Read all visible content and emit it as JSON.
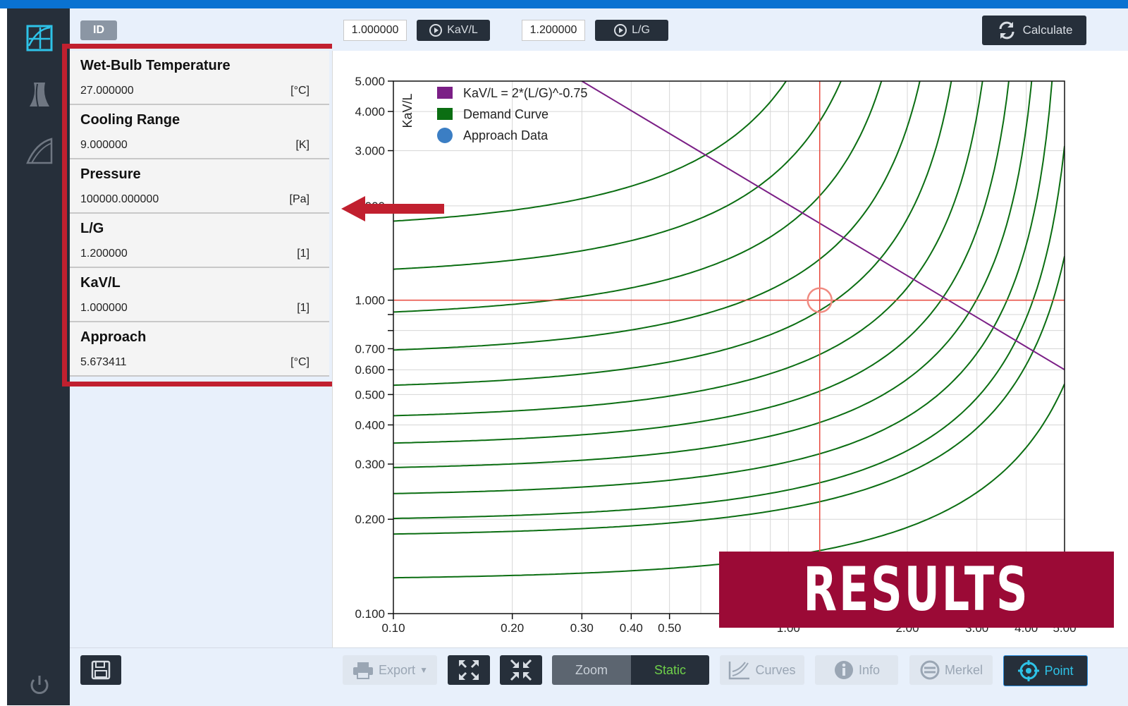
{
  "sidebar": {
    "icons": [
      "chart-icon",
      "tower-icon",
      "curve-icon",
      "power-icon"
    ]
  },
  "left_panel": {
    "id_label": "ID",
    "properties": [
      {
        "name": "Wet-Bulb Temperature",
        "value": "27.000000",
        "unit": "[°C]"
      },
      {
        "name": "Cooling Range",
        "value": "9.000000",
        "unit": "[K]"
      },
      {
        "name": "Pressure",
        "value": "100000.000000",
        "unit": "[Pa]"
      },
      {
        "name": "L/G",
        "value": "1.200000",
        "unit": "[1]"
      },
      {
        "name": "KaV/L",
        "value": "1.000000",
        "unit": "[1]"
      },
      {
        "name": "Approach",
        "value": "5.673411",
        "unit": "[°C]"
      }
    ]
  },
  "toolbar": {
    "kavl_input": "1.000000",
    "kavl_button": "KaV/L",
    "lg_input": "1.200000",
    "lg_button": "L/G",
    "calculate_button": "Calculate"
  },
  "bottom_bar": {
    "export": "Export",
    "zoom": "Zoom",
    "static": "Static",
    "curves": "Curves",
    "info": "Info",
    "merkel": "Merkel",
    "point": "Point"
  },
  "banner": {
    "text": "RESULTS"
  },
  "colors": {
    "accent_blue": "#0a72d1",
    "sidebar_dark": "#262f3a",
    "banner_red": "#9b0a36",
    "highlight_red": "#c1202f",
    "demand_green": "#0b6e12",
    "line_purple": "#7b1f86",
    "cross_red": "#e8473c"
  },
  "chart_data": {
    "type": "line",
    "xlabel": "",
    "ylabel": "KaV/L",
    "x_scale": "log",
    "y_scale": "log",
    "xlim": [
      0.1,
      5.0
    ],
    "ylim": [
      0.1,
      5.0
    ],
    "x_ticks": [
      "0.10",
      "0.20",
      "0.30",
      "0.40",
      "0.50",
      "1.00",
      "2.00",
      "3.00",
      "4.00",
      "5.00"
    ],
    "y_ticks": [
      "0.100",
      "0.200",
      "0.300",
      "0.400",
      "0.500",
      "0.600",
      "0.700",
      "1.000",
      "2.000",
      "3.000",
      "4.000",
      "5.000"
    ],
    "legend": {
      "placement": "top-left",
      "entries": [
        "KaV/L = 2*(L/G)^-0.75",
        "Demand Curve",
        "Approach Data"
      ]
    },
    "crosshair": {
      "x": 1.2,
      "y": 1.0
    },
    "approach_point": {
      "x": 1.2,
      "y": 1.0
    },
    "kavl_line": {
      "name": "KaV/L = 2*(L/G)^-0.75",
      "x": [
        0.3,
        5.0
      ],
      "y": [
        5.0,
        0.6
      ]
    },
    "demand_curves": [
      {
        "y0": 0.128,
        "k": 7.0
      },
      {
        "y0": 0.176,
        "k": 6.0
      },
      {
        "y0": 0.197,
        "k": 5.5
      },
      {
        "y0": 0.236,
        "k": 5.0
      },
      {
        "y0": 0.285,
        "k": 4.5
      },
      {
        "y0": 0.34,
        "k": 4.0
      },
      {
        "y0": 0.414,
        "k": 3.5
      },
      {
        "y0": 0.515,
        "k": 3.0
      },
      {
        "y0": 0.663,
        "k": 2.6
      },
      {
        "y0": 0.869,
        "k": 2.2
      },
      {
        "y0": 1.18,
        "k": 1.9
      },
      {
        "y0": 1.66,
        "k": 1.6
      }
    ]
  }
}
